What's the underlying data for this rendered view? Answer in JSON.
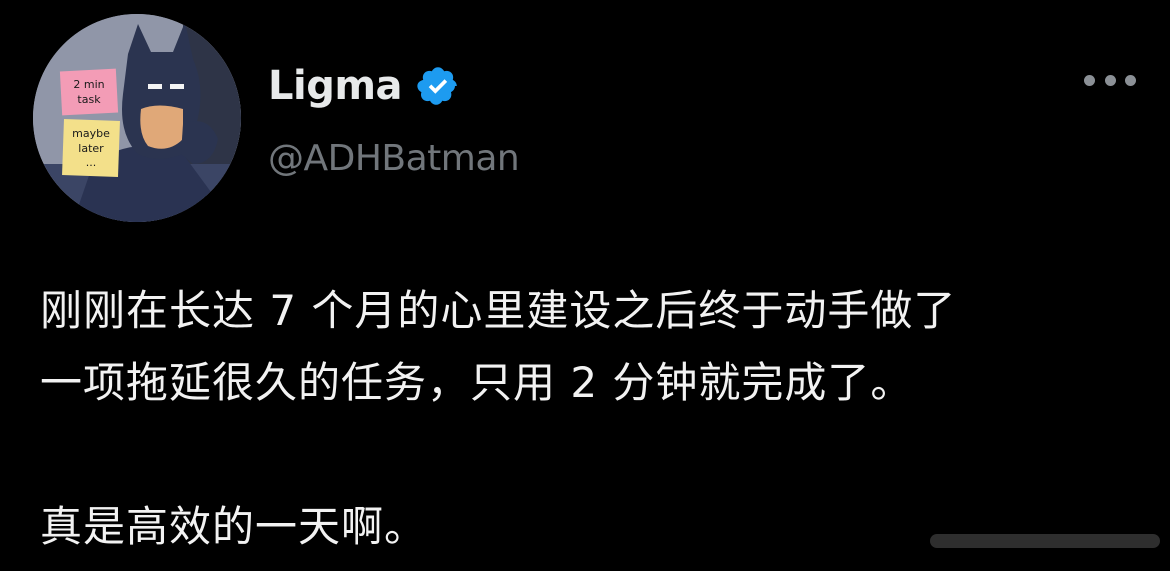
{
  "author": {
    "display_name": "Ligma",
    "handle": "@ADHBatman",
    "verified": true,
    "verified_color": "#1d9bf0"
  },
  "avatar": {
    "note_top_lines": [
      "2 min",
      "task"
    ],
    "note_bottom_lines": [
      "maybe",
      "later",
      "..."
    ]
  },
  "tweet": {
    "lines": [
      "刚刚在长达 7 个月的心里建设之后终于动手做了",
      "一项拖延很久的任务，只用 2 分钟就完成了。",
      "真是高效的一天啊。"
    ]
  },
  "icons": {
    "verified": "verified-badge-icon",
    "more": "more-options-icon"
  },
  "colors": {
    "background": "#000000",
    "text": "#f2f2f2",
    "secondary_text": "#71767b"
  }
}
